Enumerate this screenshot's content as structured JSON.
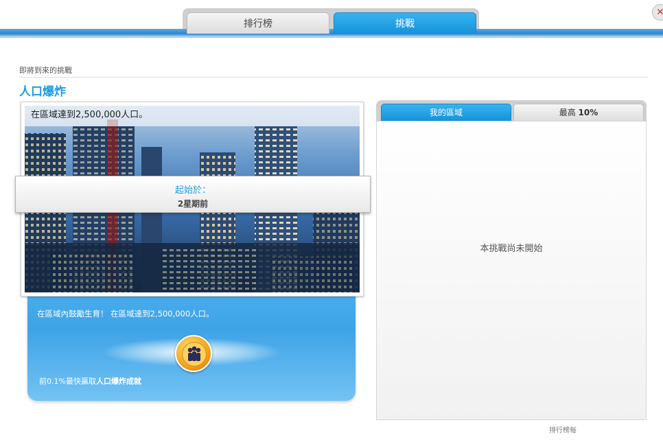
{
  "tabs": {
    "leaderboard": "排行榜",
    "challenge": "挑戰"
  },
  "section": {
    "upcoming_label": "即將到來的挑戰",
    "title": "人口爆炸"
  },
  "challenge": {
    "caption": "在區域達到2,500,000人口。",
    "start_label": "起始於：",
    "start_value": "2星期前",
    "description": "在區域內鼓勵生育！ 在區域達到2,500,000人口。",
    "reward_prefix": "前0.1%最快贏取",
    "reward_name": "人口爆炸成就"
  },
  "right_panel": {
    "tab_mine": "我的區域",
    "tab_top_prefix": "最高",
    "tab_top_value": "10%",
    "empty_message": "本挑戰尚未開始"
  },
  "footer": {
    "note": "排行榜每"
  },
  "icons": {
    "close": "close-icon",
    "badge": "population-badge-icon"
  },
  "colors": {
    "accent": "#1d9de0",
    "card": "#3ea3e6"
  }
}
